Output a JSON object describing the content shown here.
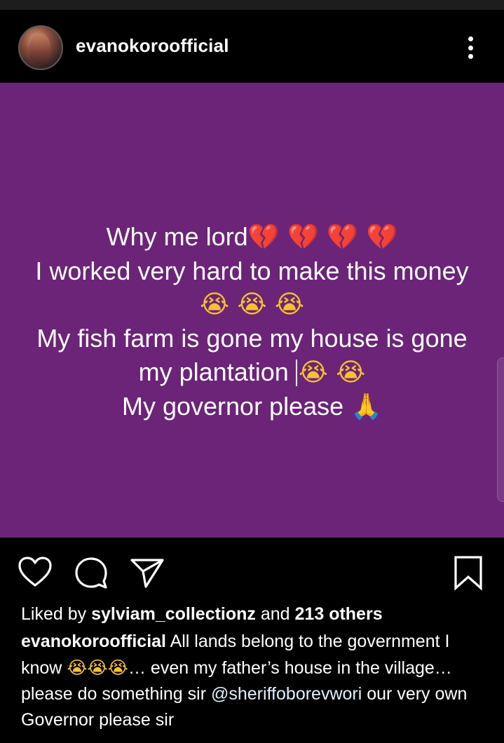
{
  "post": {
    "username": "evanokoroofficial",
    "media_text": {
      "line1": "Why me lord",
      "line1_emoji": "💔 💔 💔 💔",
      "line2": "I worked very hard to make this money",
      "line3_emoji": "😭 😭 😭",
      "line4": "My fish farm is gone my house is gone",
      "line5": "my plantation",
      "line5_emoji": "😭 😭",
      "line6": "My governor please",
      "line6_emoji": "🙏"
    },
    "background_color": "#6b2478",
    "likes": {
      "prefix": "Liked by",
      "user": "sylviam_collectionz",
      "middle": "and",
      "others": "213 others"
    },
    "caption": {
      "author": "evanokoroofficial",
      "text1": "All lands belong to the government I know",
      "emoji": "😭😭😭",
      "text2": "… even my  father’s house in the village… please do something sir",
      "mention": "@sheriffoborevwori",
      "text3": "our very own Governor please sir"
    },
    "icons": {
      "more": "more-vertical-icon",
      "like": "heart-icon",
      "comment": "comment-icon",
      "share": "send-icon",
      "save": "bookmark-icon"
    }
  }
}
